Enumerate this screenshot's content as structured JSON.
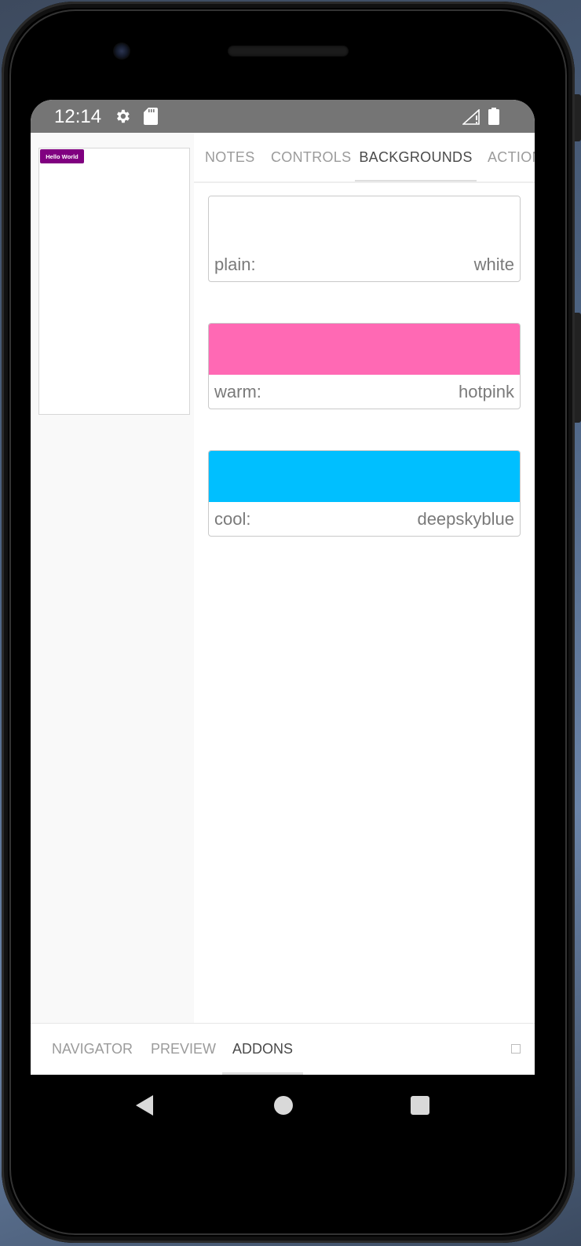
{
  "statusbar": {
    "time": "12:14",
    "icons": [
      "gear-icon",
      "sd-card-icon",
      "signal-icon",
      "battery-icon"
    ]
  },
  "preview": {
    "button_label": "Hello World",
    "button_color": "#800080"
  },
  "addon_tabs": [
    {
      "label": "NOTES",
      "active": false
    },
    {
      "label": "CONTROLS",
      "active": false
    },
    {
      "label": "BACKGROUNDS",
      "active": true
    },
    {
      "label": "ACTIONS",
      "active": false
    }
  ],
  "backgrounds": [
    {
      "name": "plain:",
      "value": "white",
      "color": "#ffffff"
    },
    {
      "name": "warm:",
      "value": "hotpink",
      "color": "#ff69b4"
    },
    {
      "name": "cool:",
      "value": "deepskyblue",
      "color": "#00bfff"
    }
  ],
  "bottom_tabs": [
    {
      "label": "NAVIGATOR",
      "active": false
    },
    {
      "label": "PREVIEW",
      "active": false
    },
    {
      "label": "ADDONS",
      "active": true
    }
  ],
  "navbar": {
    "icons": [
      "back-icon",
      "home-icon",
      "recents-icon"
    ]
  }
}
